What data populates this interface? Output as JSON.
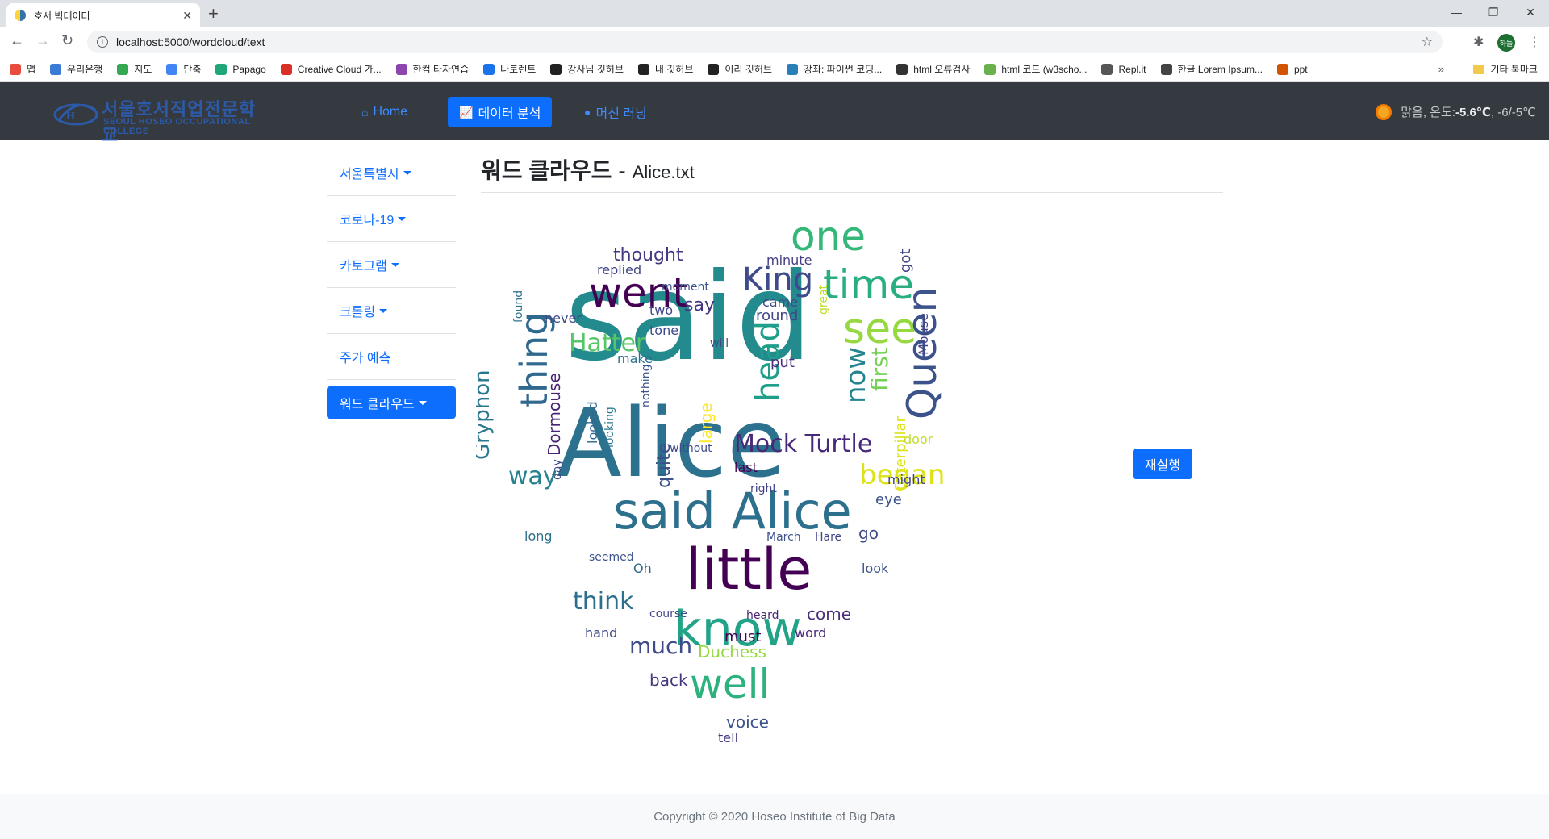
{
  "browser": {
    "tab_title": "호서 빅데이터",
    "url": "localhost:5000/wordcloud/text",
    "profile_initial": "하늘",
    "bookmarks": [
      "앱",
      "우리은행",
      "지도",
      "단축",
      "Papago",
      "Creative Cloud 가...",
      "한컴 타자연습",
      "나토렌트",
      "강사님 깃허브",
      "내 깃허브",
      "이리 깃허브",
      "강좌: 파이썬 코딩...",
      "html 오류검사",
      "html 코드 (w3scho...",
      "Repl.it",
      "한글 Lorem Ipsum...",
      "ppt"
    ],
    "bookmark_more": "»",
    "other_bookmarks": "기타 북마크"
  },
  "navbar": {
    "logo_ko": "서울호서직업전문학교",
    "logo_en": "SEOUL HOSEO OCCUPATIONAL COLLEGE",
    "links": [
      {
        "label": "Home",
        "icon": "home-icon"
      },
      {
        "label": "데이터 분석",
        "icon": "chart-line-icon"
      },
      {
        "label": "머신 러닝",
        "icon": "brain-icon"
      }
    ],
    "weather_desc": "맑음, 온도: ",
    "weather_temp": "-5.6℃",
    "weather_range": ", -6/-5℃"
  },
  "sidebar": {
    "items": [
      {
        "label": "서울특별시",
        "dropdown": true
      },
      {
        "label": "코로나-19",
        "dropdown": true
      },
      {
        "label": "카토그램",
        "dropdown": true
      },
      {
        "label": "크롤링",
        "dropdown": true
      },
      {
        "label": "주가 예측",
        "dropdown": false
      },
      {
        "label": "워드 클라우드",
        "dropdown": true
      }
    ]
  },
  "main": {
    "title": "워드 클라우드",
    "separator": "-",
    "filename": "Alice.txt",
    "rerun_button": "재실행"
  },
  "wordcloud": {
    "words": [
      "said",
      "Alice",
      "said Alice",
      "little",
      "know",
      "went",
      "thing",
      "one",
      "time",
      "King",
      "see",
      "Queen",
      "well",
      "Hatter",
      "Mock Turtle",
      "began",
      "head",
      "think",
      "way",
      "much",
      "now",
      "first",
      "Gryphon",
      "Dormouse",
      "quite",
      "thought",
      "say",
      "back",
      "voice",
      "come",
      "Duchess",
      "Caterpillar",
      "go",
      "look",
      "replied",
      "never",
      "round",
      "got",
      "minute",
      "came",
      "put",
      "last",
      "door",
      "eye",
      "might",
      "tone",
      "make",
      "must",
      "Mouse",
      "looked",
      "looking",
      "found",
      "long",
      "Hare",
      "March",
      "day",
      "two",
      "moment",
      "large",
      "tell",
      "hand",
      "word",
      "course",
      "heard",
      "seemed",
      "will",
      "Oh",
      "right",
      "great",
      "without",
      "nothing"
    ]
  },
  "colors": {
    "navbar_bg": "#343a40",
    "primary": "#0d6efd",
    "link": "#3d8bfd"
  },
  "footer": {
    "copyright": "Copyright © 2020 Hoseo Institute of Big Data"
  }
}
